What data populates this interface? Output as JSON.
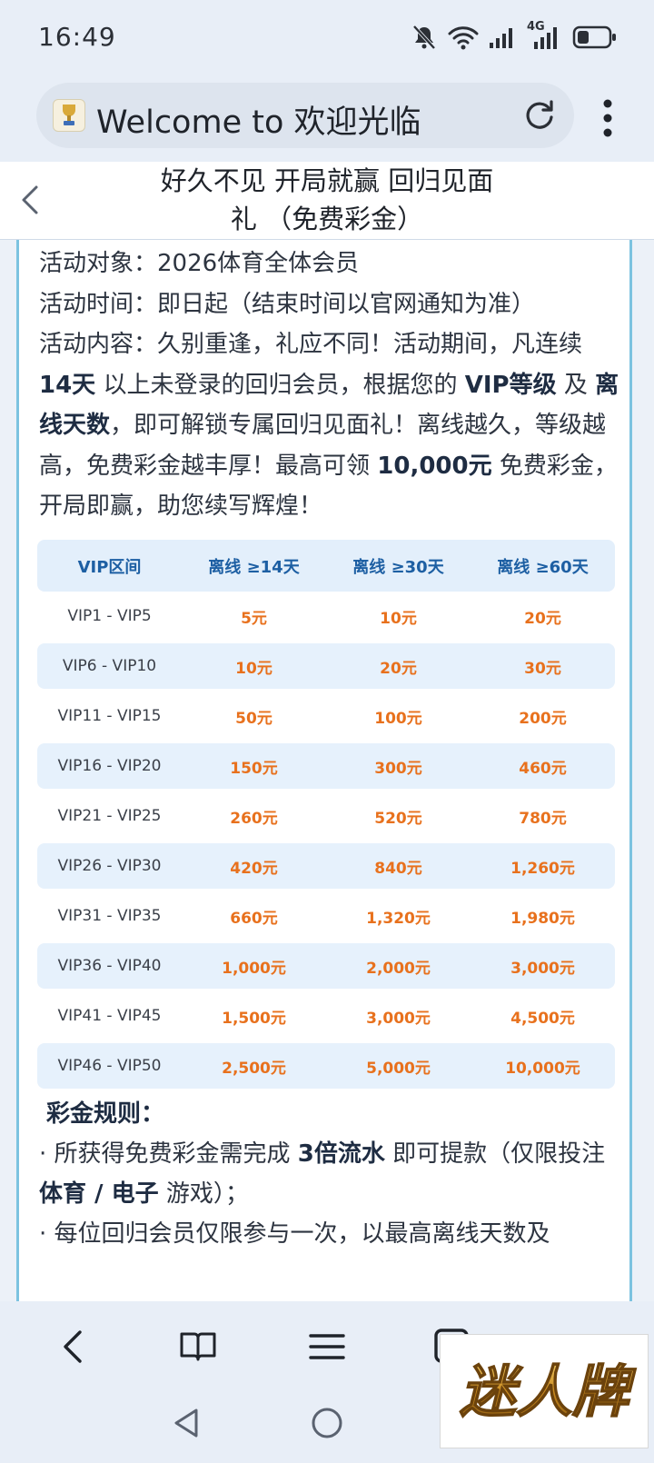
{
  "status_bar": {
    "time": "16:49",
    "network_label": "4G"
  },
  "browser": {
    "tab_title": "Welcome to 欢迎光临"
  },
  "header": {
    "title_line1": "好久不见 开局就赢 回归见面",
    "title_line2": "礼 （免费彩金）"
  },
  "intro": {
    "target_label": "活动对象：",
    "target_value": "2026体育全体会员",
    "time_label": "活动时间：",
    "time_value": "即日起（结束时间以官网通知为准）",
    "content_label": "活动内容：",
    "p1": "久别重逢，礼应不同！活动期间，凡连续 ",
    "b1": "14天",
    "p2": " 以上未登录的回归会员，根据您的 ",
    "b2": "VIP等级",
    "p3": " 及 ",
    "b3": "离线天数",
    "p4": "，即可解锁专属回归见面礼！离线越久，等级越高，免费彩金越丰厚！最高可领 ",
    "b4": "10,000元",
    "p5": " 免费彩金，开局即赢，助您续写辉煌！"
  },
  "table": {
    "headers": [
      "VIP区间",
      "离线 ≥14天",
      "离线 ≥30天",
      "离线 ≥60天"
    ],
    "rows": [
      [
        "VIP1 - VIP5",
        "5元",
        "10元",
        "20元"
      ],
      [
        "VIP6 - VIP10",
        "10元",
        "20元",
        "30元"
      ],
      [
        "VIP11 - VIP15",
        "50元",
        "100元",
        "200元"
      ],
      [
        "VIP16 - VIP20",
        "150元",
        "300元",
        "460元"
      ],
      [
        "VIP21 - VIP25",
        "260元",
        "520元",
        "780元"
      ],
      [
        "VIP26 - VIP30",
        "420元",
        "840元",
        "1,260元"
      ],
      [
        "VIP31 - VIP35",
        "660元",
        "1,320元",
        "1,980元"
      ],
      [
        "VIP36 - VIP40",
        "1,000元",
        "2,000元",
        "3,000元"
      ],
      [
        "VIP41 - VIP45",
        "1,500元",
        "3,000元",
        "4,500元"
      ],
      [
        "VIP46 - VIP50",
        "2,500元",
        "5,000元",
        "10,000元"
      ]
    ]
  },
  "rules": {
    "title": "彩金规则：",
    "r1a": "· 所获得免费彩金需完成 ",
    "r1b": "3倍流水",
    "r1c": " 即可提款（仅限投注 ",
    "r1d": "体育 / 电子",
    "r1e": "  游戏）；",
    "r2": "· 每位回归会员仅限参与一次，以最高离线天数及"
  },
  "watermark": {
    "text": "迷人牌"
  },
  "colors": {
    "accent": "#e8711d",
    "table_header_text": "#1d5fa3",
    "card_border": "#7cc3e0"
  }
}
